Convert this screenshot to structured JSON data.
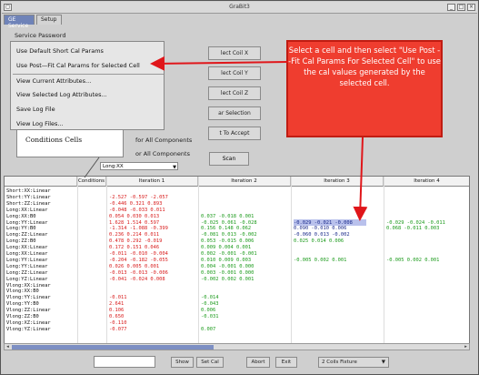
{
  "window": {
    "title": "GraBit3"
  },
  "tabs": [
    {
      "label": "GE Service"
    },
    {
      "label": "Setup"
    }
  ],
  "service": {
    "label": "Service Password",
    "menu": [
      "Use Default Short Cal Params",
      "Use Post—Fit Cal Params for Selected Cell",
      "View Current Attributes...",
      "View Selected Log Attributes...",
      "Save Log File",
      "View Log Files..."
    ],
    "right_buttons": [
      "lect Coil X",
      "lect Coil Y",
      "lect Coil Z",
      "ar Selection",
      "t To Accept"
    ],
    "for_all_1": "for All Components",
    "for_all_2": "or All Components",
    "scan_label": "Scan",
    "dropdown_value": "Long:XX"
  },
  "callout": {
    "text": "Select a cell and then select \"Use Post --Fit Cal Params For Selected Cell\" to use the cal values generated by the selected cell."
  },
  "conditions_label": "Conditions Cells",
  "grid": {
    "headers": [
      "Conditions",
      "Iteration 1",
      "Iteration 2",
      "Iteration 3",
      "Iteration 4"
    ],
    "rows": [
      {
        "name": "Short:XX:Linear",
        "c1": ""
      },
      {
        "name": "Short:YY:Linear",
        "c1": "-2.527  -0.597  -2.057"
      },
      {
        "name": "Short:ZZ:Linear",
        "c1": "-0.446   0.321   0.893"
      },
      {
        "name": "Long:XX:Linear",
        "c1": "-0.048  -0.033   0.011"
      },
      {
        "name": "Long:XX:B0",
        "c1": "0.054   0.030   0.013",
        "c2": "0.037  -0.018   0.001"
      },
      {
        "name": "Long:YY:Linear",
        "c1": "1.628   1.514   0.597",
        "c2": "-0.025   0.061  -0.028",
        "c3": "-0.029  -0.021  -0.008",
        "c4": "-0.029  -0.024  -0.011"
      },
      {
        "name": "Long:YY:B0",
        "c1": "-1.314  -1.088  -0.399",
        "c2": "0.156   0.148   0.062",
        "c3": "0.090  -0.010   0.006",
        "c4": "0.068  -0.011   0.003"
      },
      {
        "name": "Long:ZZ:Linear",
        "c1": "0.236   0.214   0.011",
        "c2": "-0.081   0.013  -0.002",
        "c3": "-0.060   0.013  -0.002"
      },
      {
        "name": "Long:ZZ:B0",
        "c1": "0.478   0.292  -0.019",
        "c2": "0.053  -0.015   0.006",
        "c3": "0.025   0.014   0.006"
      },
      {
        "name": "Long:XX:Linear",
        "c1": "0.172   0.151   0.046",
        "c2": "0.009   0.004   0.001"
      },
      {
        "name": "Long:XX:Linear",
        "c1": "-0.011  -0.010  -0.004",
        "c2": "0.002  -0.001  -0.001"
      },
      {
        "name": "Long:YY:Linear",
        "c1": "-0.204  -0.182  -0.055",
        "c2": "0.010   0.009   0.003",
        "c3": "-0.005   0.002   0.001",
        "c4": "-0.005   0.002   0.001"
      },
      {
        "name": "Long:YY:Linear",
        "c1": "0.026   0.005   0.001",
        "c2": "0.004  -0.001   0.000"
      },
      {
        "name": "Long:ZZ:Linear",
        "c1": "-0.013  -0.013  -0.006",
        "c2": "0.003  -0.001   0.000"
      },
      {
        "name": "Long:YZ:Linear",
        "c1": "-0.041  -0.024   0.008",
        "c2": "-0.002   0.002   0.001"
      },
      {
        "name": "Vlong:XX:Linear",
        "c1": ""
      },
      {
        "name": "Vlong:XX:B0",
        "c1": ""
      },
      {
        "name": "Vlong:YY:Linear",
        "c1": "-0.011",
        "c2": "-0.014"
      },
      {
        "name": "Vlong:YY:B0",
        "c1": "2.641",
        "c2": "-0.043"
      },
      {
        "name": "Vlong:ZZ:Linear",
        "c1": "0.106",
        "c2": "0.006"
      },
      {
        "name": "Vlong:ZZ:B0",
        "c1": "0.650",
        "c2": "-0.031"
      },
      {
        "name": "Vlong:XZ:Linear",
        "c1": "-0.110"
      },
      {
        "name": "Vlong:YZ:Linear",
        "c1": "-0.077",
        "c2": "0.007"
      }
    ]
  },
  "bottom": {
    "buttons": [
      "Show",
      "Set Cal",
      "Abort",
      "Exit"
    ],
    "fixture": "2 Coils Fixture"
  },
  "colors": {
    "tab_active": "#6f83b8",
    "callout": "#ef3d2f",
    "value_red": "#d81b1b",
    "value_green": "#1b9a1b",
    "selection": "#b9c1ec"
  }
}
